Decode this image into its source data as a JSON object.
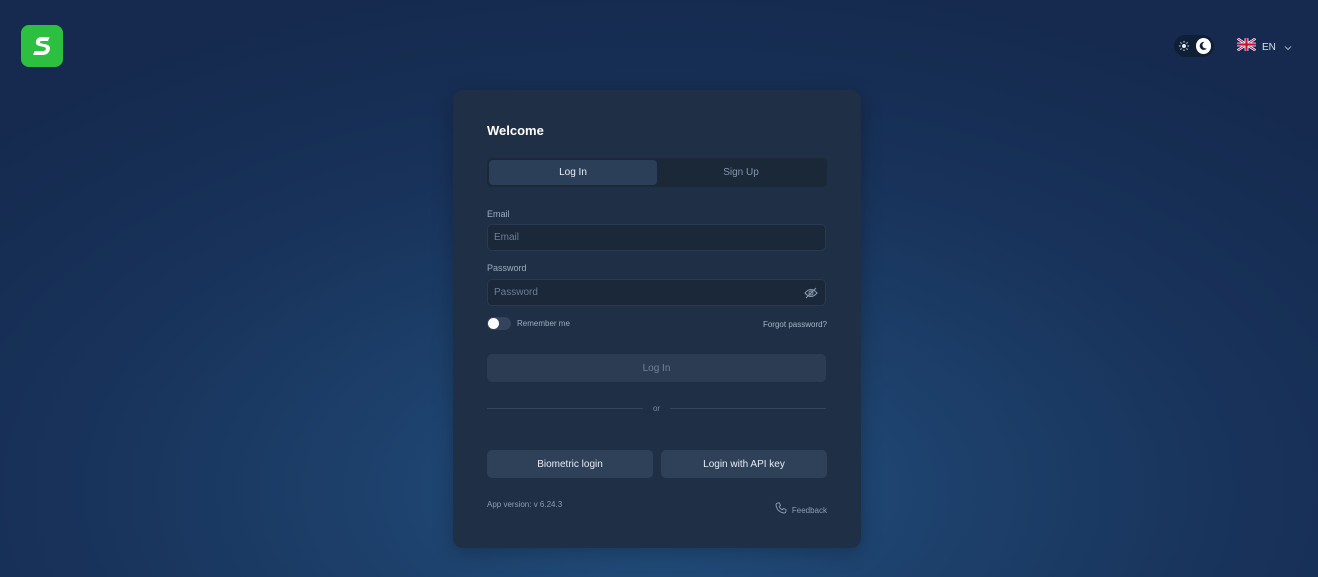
{
  "header": {
    "logo_icon": "app-logo-s",
    "theme_toggle": {
      "sun_icon": "sun-icon",
      "moon_icon": "moon-icon",
      "current": "dark"
    },
    "language": {
      "flag_icon": "uk-flag-icon",
      "code": "EN"
    }
  },
  "login_card": {
    "title": "Welcome",
    "tabs": [
      {
        "label": "Log In",
        "active": true
      },
      {
        "label": "Sign Up",
        "active": false
      }
    ],
    "email": {
      "label": "Email",
      "placeholder": "Email",
      "value": ""
    },
    "password": {
      "label": "Password",
      "placeholder": "Password",
      "value": "",
      "toggle_icon": "eye-off-icon"
    },
    "remember_me": {
      "label": "Remember me",
      "checked": false
    },
    "forgot_password": "Forgot password?",
    "login_button": "Log In",
    "divider_text": "or",
    "alt_buttons": {
      "biometric": "Biometric login",
      "api_key": "Login with API key"
    },
    "app_version": "App version: v 6.24.3",
    "feedback": {
      "label": "Feedback",
      "icon": "phone-icon"
    }
  },
  "colors": {
    "brand_green": "#2dbf3f",
    "card_bg": "#1f2f45",
    "background": "#1c3f69"
  }
}
